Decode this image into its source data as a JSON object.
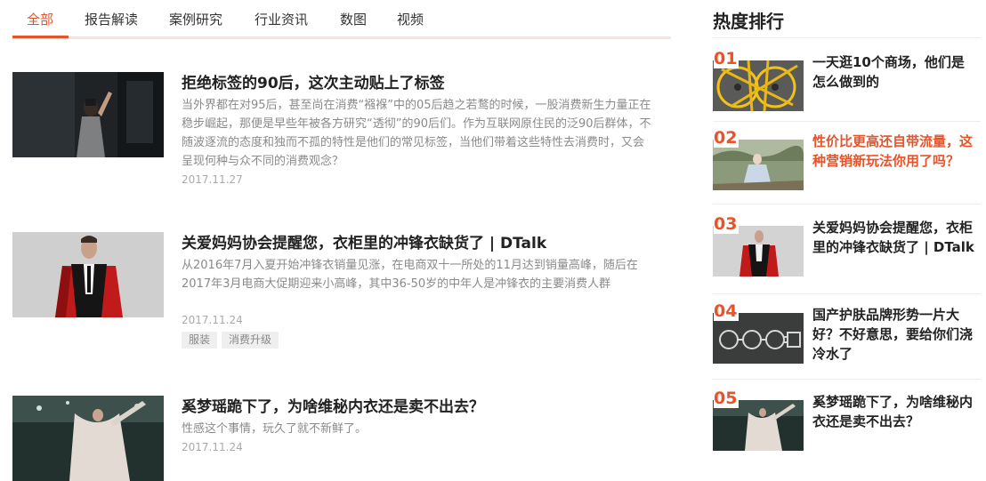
{
  "tabs": [
    {
      "label": "全部",
      "active": true
    },
    {
      "label": "报告解读",
      "active": false
    },
    {
      "label": "案例研究",
      "active": false
    },
    {
      "label": "行业资讯",
      "active": false
    },
    {
      "label": "数图",
      "active": false
    },
    {
      "label": "视频",
      "active": false
    }
  ],
  "articles": [
    {
      "title": "拒绝标签的90后，这次主动贴上了标签",
      "summary": "当外界都在对95后，甚至尚在消费“襁褓”中的05后趋之若鹜的时候，一股消费新生力量正在稳步崛起，那便是早些年被各方研究“透彻”的90后们。作为互联网原住民的泛90后群体，不随波逐流的态度和独而不孤的特性是他们的常见标签，当他们带着这些特性去消费时，又会呈现何种与众不同的消费观念？",
      "date": "2017.11.27",
      "tags": []
    },
    {
      "title": "关爱妈妈协会提醒您，衣柜里的冲锋衣缺货了 | DTalk",
      "summary": "从2016年7月入夏开始冲锋衣销量见涨，在电商双十一所处的11月达到销量高峰，随后在2017年3月电商大促期迎来小高峰，其中36-50岁的中年人是冲锋衣的主要消费人群",
      "date": "2017.11.24",
      "tags": [
        "服装",
        "消费升级"
      ]
    },
    {
      "title": "奚梦瑶跪下了，为啥维秘内衣还是卖不出去？",
      "summary": "性感这个事情，玩久了就不新鲜了。",
      "date": "2017.11.24",
      "tags": []
    }
  ],
  "sidebar": {
    "title": "热度排行",
    "items": [
      {
        "rank": "01",
        "title": "一天逛10个商场，他们是怎么做到的",
        "highlighted": false
      },
      {
        "rank": "02",
        "title": "性价比更高还自带流量，这种营销新玩法你用了吗？",
        "highlighted": true
      },
      {
        "rank": "03",
        "title": "关爱妈妈协会提醒您，衣柜里的冲锋衣缺货了 | DTalk",
        "highlighted": false
      },
      {
        "rank": "04",
        "title": "国产护肤品牌形势一片大好？不好意思，要给你们浇冷水了",
        "highlighted": false
      },
      {
        "rank": "05",
        "title": "奚梦瑶跪下了，为啥维秘内衣还是卖不出去？",
        "highlighted": false
      }
    ]
  },
  "colors": {
    "accent": "#e8532a",
    "tab_rule": "#f9e3dc",
    "muted_text": "#8a8a8a"
  }
}
